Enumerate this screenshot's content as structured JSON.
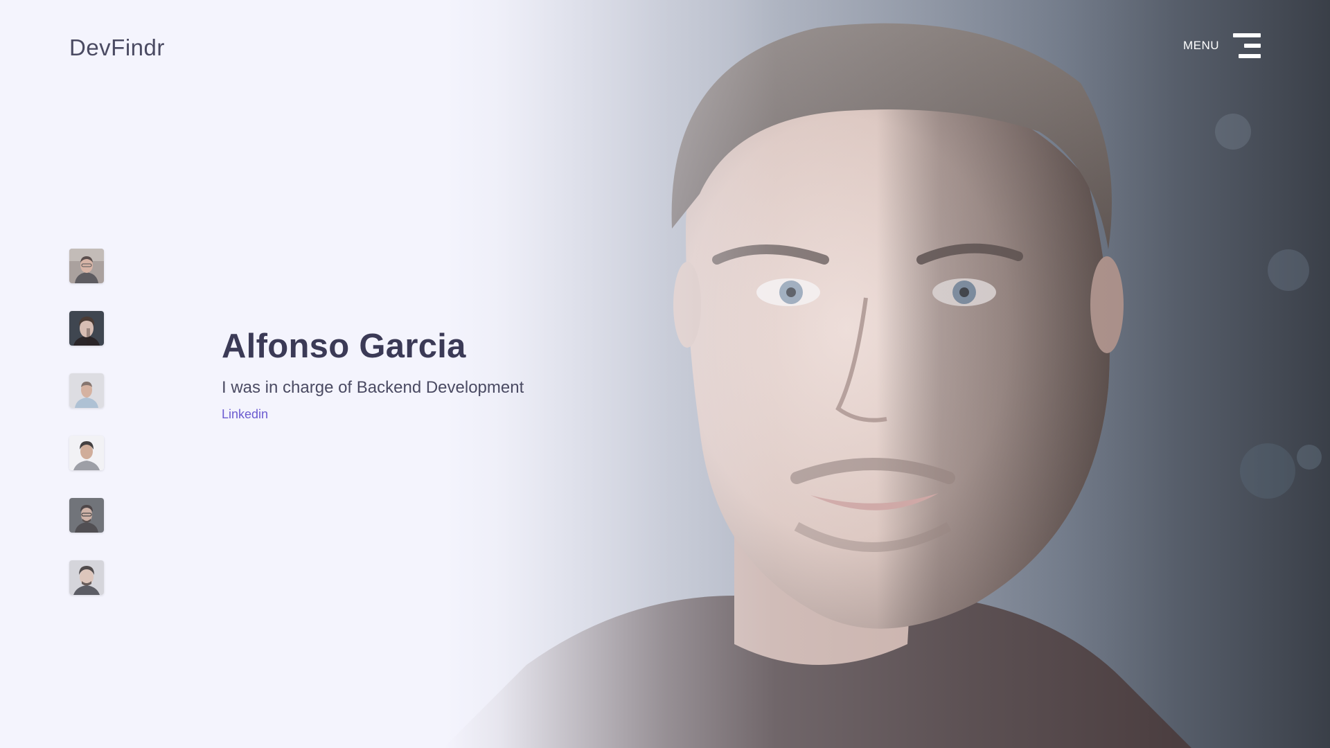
{
  "app": {
    "logo": "DevFindr"
  },
  "header": {
    "menu_label": "MENU"
  },
  "colors": {
    "background": "#f4f4fd",
    "heading": "#3b3a56",
    "text": "#4a4a62",
    "link": "#6b5bd0",
    "menu": "#ffffff"
  },
  "team": {
    "selected_index": 1,
    "members": [
      {
        "avatar": "person-1-avatar"
      },
      {
        "avatar": "person-2-avatar"
      },
      {
        "avatar": "person-3-avatar"
      },
      {
        "avatar": "person-4-avatar"
      },
      {
        "avatar": "person-5-avatar"
      },
      {
        "avatar": "person-6-avatar"
      }
    ]
  },
  "profile": {
    "name": "Alfonso Garcia",
    "role": "I was in charge of Backend Development",
    "link_label": "Linkedin"
  }
}
